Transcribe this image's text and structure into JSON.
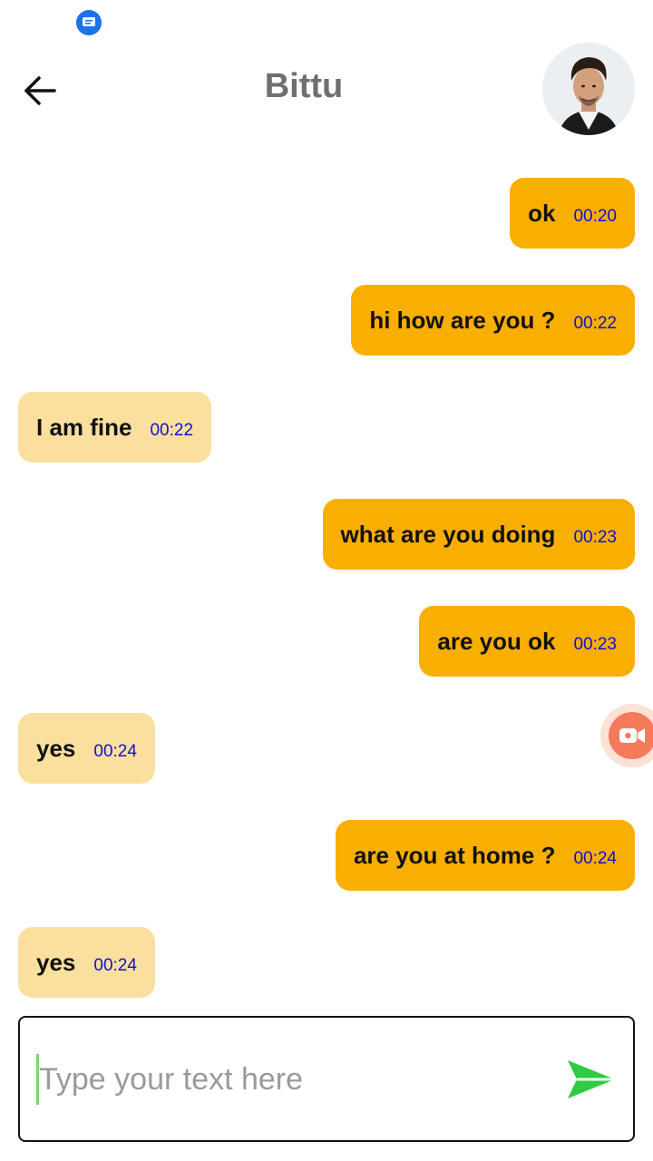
{
  "status_bar": {
    "notification_icon": "message-notification-icon"
  },
  "header": {
    "title": "Bittu",
    "back_icon": "arrow-left-icon",
    "avatar_alt": "Bittu"
  },
  "messages": [
    {
      "direction": "sent",
      "text": "ok",
      "time": "00:20"
    },
    {
      "direction": "sent",
      "text": "hi how are you ?",
      "time": "00:22"
    },
    {
      "direction": "received",
      "text": "I am fine",
      "time": "00:22"
    },
    {
      "direction": "sent",
      "text": "what are you doing",
      "time": "00:23"
    },
    {
      "direction": "sent",
      "text": "are you ok",
      "time": "00:23"
    },
    {
      "direction": "received",
      "text": "yes",
      "time": "00:24"
    },
    {
      "direction": "sent",
      "text": "are you at home ?",
      "time": "00:24"
    },
    {
      "direction": "received",
      "text": "yes",
      "time": "00:24"
    }
  ],
  "floating": {
    "record_icon": "video-camera-icon"
  },
  "composer": {
    "placeholder": "Type your text here",
    "value": "",
    "send_icon": "send-icon"
  },
  "colors": {
    "sent_bubble": "#f9ae02",
    "received_bubble": "#fbdf9e",
    "timestamp": "#1010d0",
    "send_icon": "#2ecc40"
  }
}
